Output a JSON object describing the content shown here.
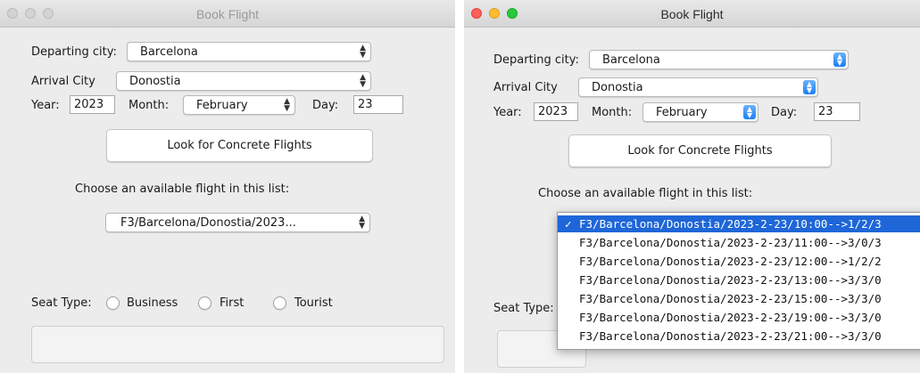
{
  "left_window": {
    "title": "Book Flight",
    "labels": {
      "departing": "Departing city:",
      "arrival": "Arrival City",
      "year": "Year:",
      "month": "Month:",
      "day": "Day:",
      "choose": "Choose an available flight in this list:",
      "seat_type": "Seat Type:"
    },
    "departing_city": "Barcelona",
    "arrival_city": "Donostia",
    "year": "2023",
    "month": "February",
    "day": "23",
    "search_button": "Look for Concrete Flights",
    "flight_selected": "F3/Barcelona/Donostia/2023...",
    "seat_options": [
      "Business",
      "First",
      "Tourist"
    ]
  },
  "right_window": {
    "title": "Book Flight",
    "labels": {
      "departing": "Departing city:",
      "arrival": "Arrival City",
      "year": "Year:",
      "month": "Month:",
      "day": "Day:",
      "choose": "Choose an available flight in this list:",
      "seat_type": "Seat Type:"
    },
    "departing_city": "Barcelona",
    "arrival_city": "Donostia",
    "year": "2023",
    "month": "February",
    "day": "23",
    "search_button": "Look for Concrete Flights",
    "checkmark": "✓",
    "flight_options": [
      "F3/Barcelona/Donostia/2023-2-23/10:00-->1/2/3",
      "F3/Barcelona/Donostia/2023-2-23/11:00-->3/0/3",
      "F3/Barcelona/Donostia/2023-2-23/12:00-->1/2/2",
      "F3/Barcelona/Donostia/2023-2-23/13:00-->3/3/0",
      "F3/Barcelona/Donostia/2023-2-23/15:00-->3/3/0",
      "F3/Barcelona/Donostia/2023-2-23/19:00-->3/3/0",
      "F3/Barcelona/Donostia/2023-2-23/21:00-->3/3/0"
    ]
  },
  "colors": {
    "window_bg": "#ececec",
    "selection": "#1e66d8",
    "combo_arrow_active": "#1a7ef6"
  }
}
